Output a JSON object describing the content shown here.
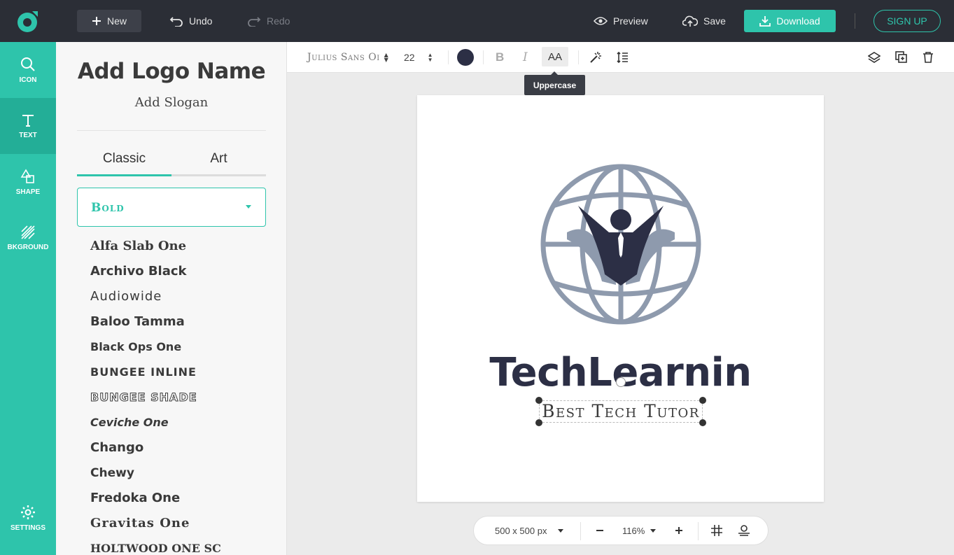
{
  "topbar": {
    "new_label": "New",
    "undo_label": "Undo",
    "redo_label": "Redo",
    "preview_label": "Preview",
    "save_label": "Save",
    "download_label": "Download",
    "signup_label": "SIGN UP"
  },
  "rail": {
    "items": [
      {
        "label": "ICON",
        "icon": "search-icon"
      },
      {
        "label": "TEXT",
        "icon": "text-icon"
      },
      {
        "label": "SHAPE",
        "icon": "shape-icon"
      },
      {
        "label": "BKGROUND",
        "icon": "background-icon"
      }
    ],
    "settings_label": "SETTINGS"
  },
  "panel": {
    "title": "Add Logo Name",
    "slogan": "Add Slogan",
    "tabs": [
      "Classic",
      "Art"
    ],
    "selected_category": "Bold",
    "fonts": [
      "Alfa Slab One",
      "Archivo Black",
      "Audiowide",
      "Baloo Tamma",
      "Black Ops One",
      "BUNGEE INLINE",
      "BUNGEE SHADE",
      "Ceviche One",
      "Chango",
      "Chewy",
      "Fredoka One",
      "Gravitas One",
      "HOLTWOOD ONE SC"
    ]
  },
  "toolbar": {
    "font_name": "Julius Sans Oi",
    "font_size": "22",
    "text_color": "#2c2f45",
    "bold": "B",
    "italic": "I",
    "uppercase": "AA",
    "tooltip": "Uppercase"
  },
  "canvas": {
    "brand_name": "TechLearnin",
    "slogan": "Best Tech Tutor",
    "icon_color": "#8e9aad",
    "figure_color": "#2c2f45"
  },
  "zoombar": {
    "size_label": "500 x 500 px",
    "zoom_label": "116%"
  },
  "colors": {
    "accent": "#2ec4ab",
    "topbar": "#2b2e36"
  }
}
